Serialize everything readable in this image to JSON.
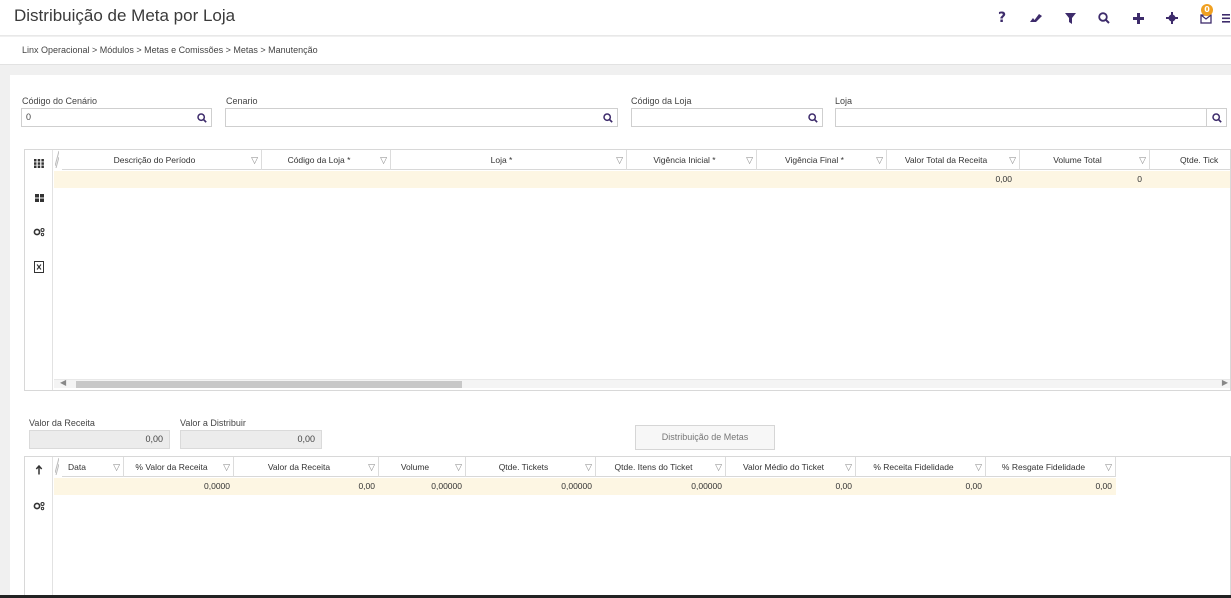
{
  "page": {
    "title": "Distribuição de Meta por Loja"
  },
  "toolbar": {
    "icons": [
      "help-icon",
      "eraser-icon",
      "filter-icon",
      "search-icon",
      "add-icon",
      "gear-icon",
      "notifications-icon",
      "menu-icon"
    ],
    "help_label": "?",
    "notification_count": "0"
  },
  "breadcrumb": {
    "items": [
      "Linx Operacional",
      "Módulos",
      "Metas e Comissões",
      "Metas",
      "Manutenção"
    ],
    "text": "Linx Operacional  >  Módulos  >  Metas e Comissões  >  Metas  >  Manutenção"
  },
  "filters": {
    "codigo_cenario": {
      "label": "Código do Cenário",
      "value": "0"
    },
    "cenario": {
      "label": "Cenario",
      "value": ""
    },
    "codigo_loja": {
      "label": "Código da Loja",
      "value": ""
    },
    "loja": {
      "label": "Loja",
      "value": ""
    }
  },
  "top_grid": {
    "columns": [
      "Descrição do Período",
      "Código da Loja *",
      "Loja *",
      "Vigência Inicial *",
      "Vigência Final *",
      "Valor Total da Receita",
      "Volume Total",
      "Qtde. Tick"
    ],
    "row": {
      "valor_total_receita": "0,00",
      "volume_total": "0"
    },
    "side_icons": [
      "grid-columns-icon",
      "layout-icon",
      "settings-icon",
      "excel-export-icon"
    ]
  },
  "summary": {
    "valor_receita": {
      "label": "Valor da Receita",
      "value": "0,00"
    },
    "valor_distribuir": {
      "label": "Valor a Distribuir",
      "value": "0,00"
    },
    "dist_button": "Distribuição de Metas"
  },
  "bottom_grid": {
    "columns": [
      "Data",
      "% Valor da Receita",
      "Valor da Receita",
      "Volume",
      "Qtde. Tickets",
      "Qtde. Itens do Ticket",
      "Valor Médio do Ticket",
      "% Receita Fidelidade",
      "% Resgate Fidelidade"
    ],
    "row": [
      "",
      "0,0000",
      "0,00",
      "0,00000",
      "0,00000",
      "0,00000",
      "0,00",
      "0,00",
      "0,00"
    ],
    "side_icons": [
      "sort-up-icon",
      "settings-icon"
    ]
  },
  "colors": {
    "accent": "#3d2b6b",
    "row_highlight": "#fdf6e3",
    "badge": "#f0a020"
  }
}
